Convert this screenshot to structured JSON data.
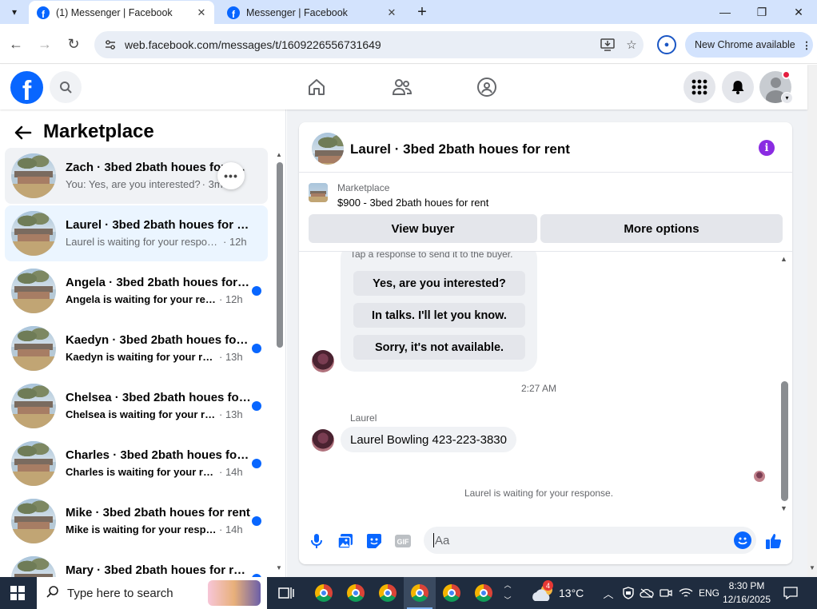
{
  "browser": {
    "tabs": [
      {
        "title": "(1) Messenger | Facebook",
        "active": true
      },
      {
        "title": "Messenger | Facebook",
        "active": false
      }
    ],
    "url": "web.facebook.com/messages/t/1609226556731649",
    "update_chip": "New Chrome available"
  },
  "sidebar": {
    "title": "Marketplace",
    "conversations": [
      {
        "name": "Zach · 3bed 2bath houes for rent",
        "snippet": "You: Yes, are you interested?",
        "time": "· 3m",
        "unread": false
      },
      {
        "name": "Laurel · 3bed 2bath houes for rent",
        "snippet": "Laurel is waiting for your response.",
        "time": "· 12h",
        "unread": false
      },
      {
        "name": "Angela · 3bed 2bath houes for rent",
        "snippet": "Angela is waiting for your response.",
        "time": "· 12h",
        "unread": true
      },
      {
        "name": "Kaedyn · 3bed 2bath houes for rent",
        "snippet": "Kaedyn is waiting for your response.",
        "time": "· 13h",
        "unread": true
      },
      {
        "name": "Chelsea · 3bed 2bath houes for rent",
        "snippet": "Chelsea is waiting for your response.",
        "time": "· 13h",
        "unread": true
      },
      {
        "name": "Charles · 3bed 2bath houes for rent",
        "snippet": "Charles is waiting for your response.",
        "time": "· 14h",
        "unread": true
      },
      {
        "name": "Mike · 3bed 2bath houes for rent",
        "snippet": "Mike is waiting for your response.",
        "time": "· 14h",
        "unread": true
      },
      {
        "name": "Mary · 3bed 2bath houes for rent",
        "snippet": "",
        "time": "",
        "unread": true
      }
    ]
  },
  "chat": {
    "title": "Laurel · 3bed 2bath houes for rent",
    "listing_label": "Marketplace",
    "listing_price_title": "$900 - 3bed 2bath houes for rent",
    "view_buyer": "View buyer",
    "more_options": "More options",
    "quick_hint": "Tap a response to send it to the buyer.",
    "quick_replies": [
      "Yes, are you interested?",
      "In talks. I'll let you know.",
      "Sorry, it's not available."
    ],
    "timestamp": "2:27 AM",
    "sender": "Laurel",
    "message": "Laurel Bowling 423-223-3830",
    "waiting_note": "Laurel is waiting for your response.",
    "composer_placeholder": "Aa"
  },
  "taskbar": {
    "search_placeholder": "Type here to search",
    "weather": "13°C",
    "weather_badge": "4",
    "language": "ENG",
    "time": "8:30 PM",
    "date": "12/16/2025"
  },
  "colors": {
    "facebook_blue": "#0866ff",
    "info_purple": "#8a2be2",
    "unread_dot": "#0866ff",
    "chrome_chip": "#d3e3fd",
    "taskbar": "#1f2c3f"
  }
}
